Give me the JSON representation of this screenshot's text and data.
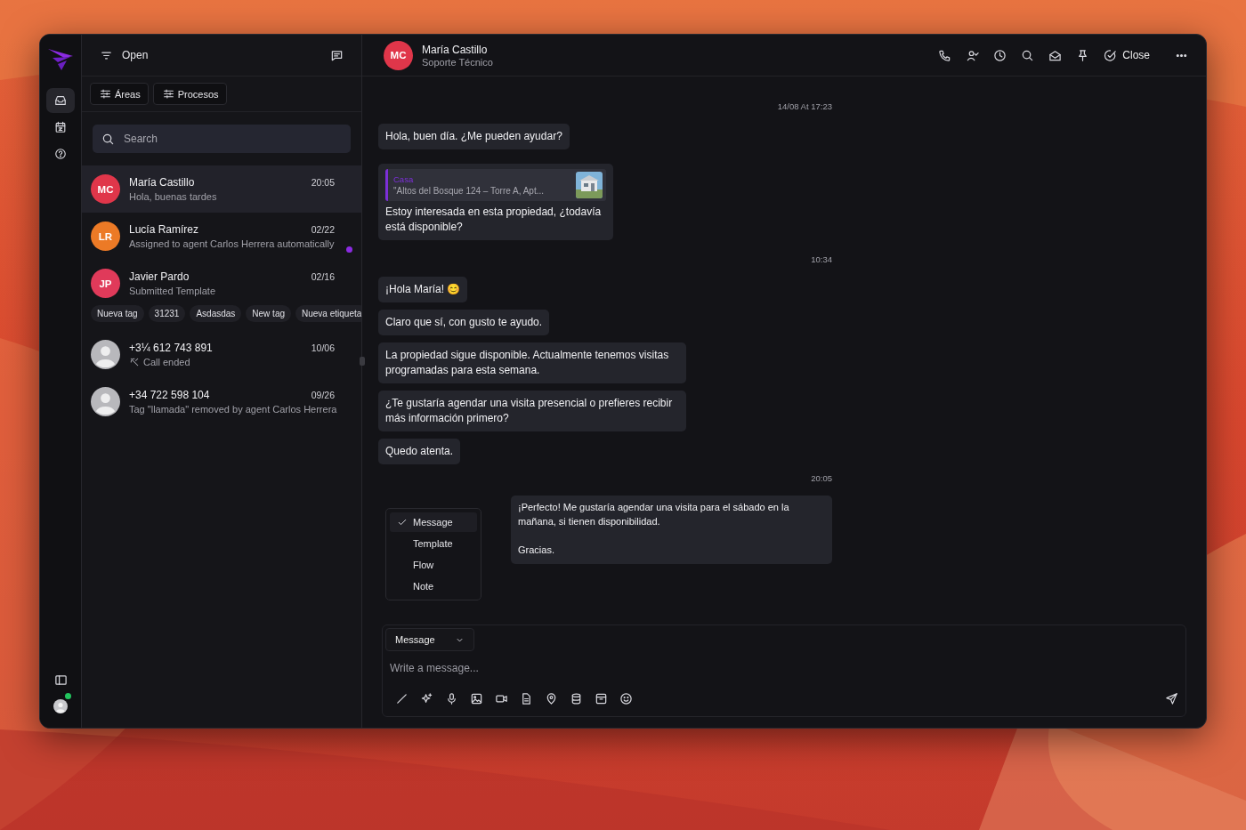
{
  "rail": {
    "items": [
      {
        "selected": true
      },
      {
        "selected": false
      },
      {
        "selected": false
      }
    ],
    "user_online": true
  },
  "inbox": {
    "filter": "Open",
    "chips": [
      "Áreas",
      "Procesos"
    ],
    "search": {
      "placeholder": "Search"
    },
    "conversations": [
      {
        "kind": "initials",
        "initials": "MC",
        "color": "#e0364a",
        "name": "María Castillo",
        "time": "20:05",
        "preview": "Hola, buenas tardes",
        "call": false,
        "unread": false,
        "selected": true
      },
      {
        "kind": "initials",
        "initials": "LR",
        "color": "#ec7a26",
        "name": "Lucía Ramírez",
        "time": "02/22",
        "preview": "Assigned to agent Carlos Herrera automatically",
        "call": false,
        "unread": true,
        "selected": false
      },
      {
        "kind": "initials",
        "initials": "JP",
        "color": "#e03a5a",
        "name": "Javier Pardo",
        "time": "02/16",
        "preview": "Submitted Template",
        "call": false,
        "unread": false,
        "selected": false,
        "tags": [
          "Nueva tag",
          "31231",
          "Asdasdas",
          "New tag",
          "Nueva etiqueta"
        ]
      },
      {
        "kind": "generic",
        "name": "+3¼ 612 743 891",
        "time": "10/06",
        "preview": "Call ended",
        "call": true,
        "unread": false,
        "selected": false
      },
      {
        "kind": "generic",
        "name": "+34 722 598 104",
        "time": "09/26",
        "preview": "Tag \"llamada\" removed by agent Carlos Herrera",
        "call": false,
        "unread": false,
        "selected": false
      }
    ]
  },
  "chat": {
    "contact": {
      "initials": "MC",
      "color": "#e0364a",
      "name": "María Castillo",
      "subtitle": "Soporte Técnico"
    },
    "close_label": "Close",
    "messages": [
      {
        "kind": "timestamp",
        "text": "14/08 At 17:23"
      },
      {
        "kind": "incoming",
        "text": "Hola, buen día. ¿Me pueden ayudar?"
      },
      {
        "kind": "quote",
        "quote_title": "Casa",
        "quote_text": "\"Altos del Bosque 124 – Torre A, Apt...",
        "text": "Estoy interesada en esta propiedad, ¿todavía está disponible?"
      },
      {
        "kind": "timestamp",
        "text": "10:34"
      },
      {
        "kind": "incoming",
        "text": "¡Hola María! 😊"
      },
      {
        "kind": "incoming",
        "text": "Claro que sí, con gusto te ayudo."
      },
      {
        "kind": "incoming",
        "text": "La propiedad sigue disponible. Actualmente tenemos visitas programadas para esta semana."
      },
      {
        "kind": "incoming",
        "text": "¿Te gustaría agendar una visita presencial o prefieres recibir más información primero?"
      },
      {
        "kind": "incoming",
        "text": "Quedo atenta."
      },
      {
        "kind": "timestamp",
        "text": "20:05"
      },
      {
        "kind": "outgoing",
        "text": "¡Perfecto! Me gustaría agendar una visita para el sábado en la mañana, si tienen disponibilidad.\n\nGracias."
      }
    ],
    "type_menu": [
      {
        "label": "Message",
        "selected": true
      },
      {
        "label": "Template",
        "selected": false
      },
      {
        "label": "Flow",
        "selected": false
      },
      {
        "label": "Note",
        "selected": false
      }
    ],
    "composer": {
      "type": "Message",
      "placeholder": "Write a message..."
    }
  }
}
